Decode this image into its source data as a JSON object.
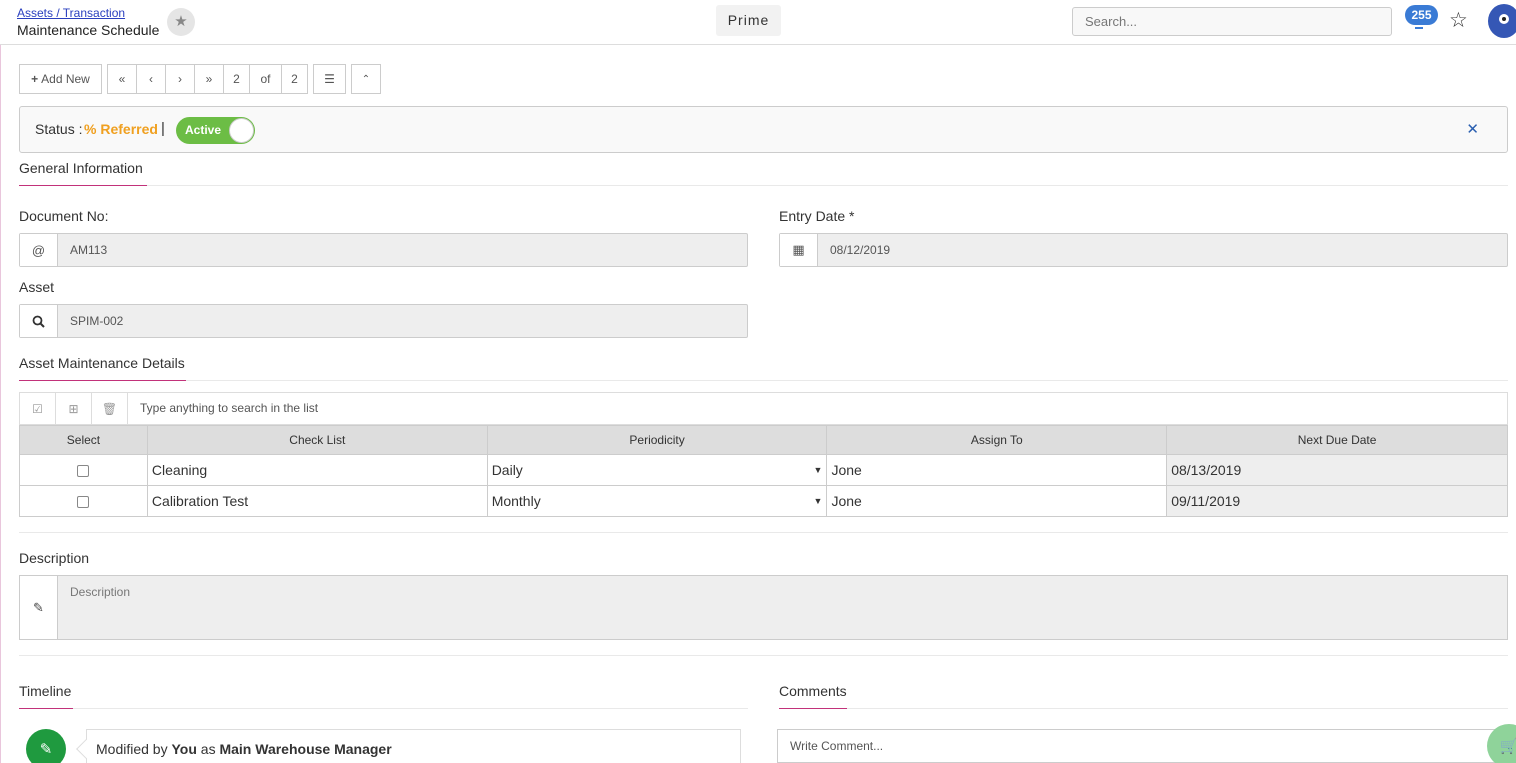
{
  "header": {
    "breadcrumb": "Assets / Transaction",
    "title": "Maintenance Schedule",
    "brand": "Prime",
    "search_placeholder": "Search...",
    "notification_count": "255"
  },
  "toolbar": {
    "add_new": "Add New",
    "current_page": "2",
    "of_label": "of",
    "total_pages": "2"
  },
  "status": {
    "label": "Status :",
    "value": "Referred",
    "separator": "|",
    "toggle_label": "Active",
    "toggle_on": true
  },
  "general": {
    "heading": "General Information",
    "document_no_label": "Document No:",
    "document_no": "AM113",
    "entry_date_label": "Entry Date *",
    "entry_date": "08/12/2019",
    "asset_label": "Asset",
    "asset": "SPIM-002"
  },
  "details": {
    "heading": "Asset Maintenance Details",
    "search_placeholder": "Type anything to search in the list",
    "columns": [
      "Select",
      "Check List",
      "Periodicity",
      "Assign To",
      "Next Due Date"
    ],
    "rows": [
      {
        "check_list": "Cleaning",
        "periodicity": "Daily",
        "assign_to": "Jone",
        "next_due": "08/13/2019"
      },
      {
        "check_list": "Calibration Test",
        "periodicity": "Monthly",
        "assign_to": "Jone",
        "next_due": "09/11/2019"
      }
    ]
  },
  "description": {
    "label": "Description",
    "placeholder": "Description"
  },
  "timeline": {
    "heading": "Timeline",
    "prefix": "Modified by",
    "actor": "You",
    "middle": "as",
    "role": "Main Warehouse Manager"
  },
  "comments": {
    "heading": "Comments",
    "placeholder": "Write Comment..."
  },
  "colors": {
    "accent": "#c2327a",
    "status": "#f0a020",
    "toggle": "#6cbd45",
    "timeline_icon": "#1f9a3f"
  }
}
